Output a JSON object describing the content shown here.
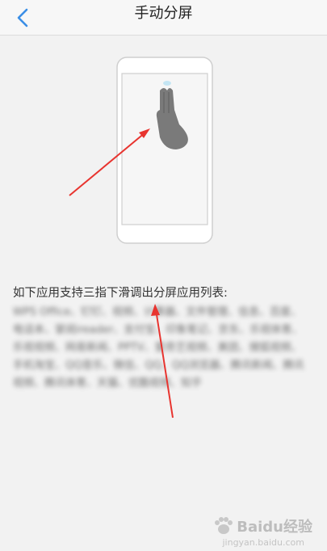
{
  "header": {
    "title": "手动分屏",
    "back_icon": "chevron-left-icon"
  },
  "content": {
    "intro_text": "如下应用支持三指下滑调出分屏应用列表:",
    "apps_text": "WPS Office、钉钉、视频、计算器、文件管理、信息、百度、电话本、掌阅ireader、支付宝、印象笔记、京东、乐视体育、乐视视频、网易新闻、PPTV、爱奇艺视频、美团、搜狐视频、手机淘宝、QQ音乐、微信、QQ、QQ浏览器、腾讯新闻、腾讯视频、腾讯体育、天猫、优酷视频、知乎"
  },
  "watermark": {
    "brand": "Baidu经验",
    "sub": "jingyan.baidu.com"
  },
  "colors": {
    "accent": "#3a8ee6",
    "arrow": "#e8342f",
    "hand": "#7a7a7a",
    "background": "#f2f2f2"
  }
}
